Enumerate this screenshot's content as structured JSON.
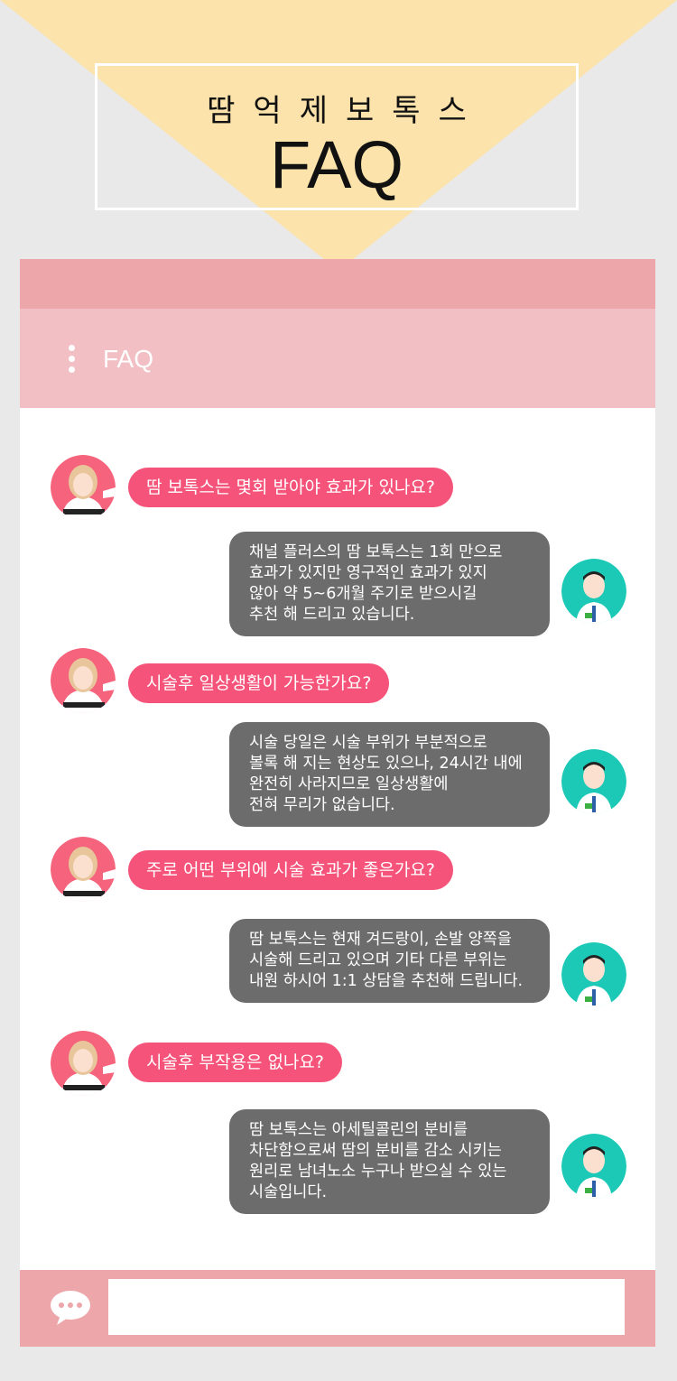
{
  "banner": {
    "subtitle": "땀억제보톡스",
    "title": "FAQ"
  },
  "header": {
    "title": "FAQ"
  },
  "messages": [
    {
      "question": "땀 보톡스는 몇회 받아야 효과가 있나요?",
      "answer": [
        "채널 플러스의 땀 보톡스는 1회 만으로",
        "효과가 있지만 영구적인 효과가 있지",
        "않아 약 5~6개월 주기로 받으시길",
        "추천 해 드리고 있습니다."
      ]
    },
    {
      "question": "시술후 일상생활이 가능한가요?",
      "answer": [
        "시술 당일은 시술 부위가 부분적으로",
        "볼록 해 지는 현상도 있으나, 24시간 내에",
        "완전히 사라지므로 일상생활에",
        "전혀 무리가 없습니다."
      ]
    },
    {
      "question": "주로 어떤 부위에 시술 효과가 좋은가요?",
      "answer": [
        "땀 보톡스는 현재 겨드랑이, 손발 양쪽을",
        "시술해 드리고 있으며 기타 다른 부위는",
        "내원 하시어 1:1 상담을 추천해 드립니다."
      ]
    },
    {
      "question": "시술후 부작용은 없나요?",
      "answer": [
        "땀 보톡스는 아세틸콜린의 분비를",
        "차단함으로써 땀의 분비를 감소 시키는",
        "원리로 남녀노소 누구나 받으실 수 있는",
        "시술입니다."
      ]
    }
  ],
  "icons": {
    "menu": "vertical-dots-icon",
    "chat": "speech-bubble-icon",
    "customer_avatar": "woman-avatar",
    "doctor_avatar": "doctor-avatar"
  },
  "colors": {
    "question_bubble": "#f5537a",
    "answer_bubble": "#6c6c6c",
    "header": "#f2c0c4",
    "top_bar": "#eda7aa",
    "triangle": "#fbe3ab",
    "doctor_bg": "#1cc9b7"
  },
  "input": {
    "value": "",
    "placeholder": ""
  }
}
